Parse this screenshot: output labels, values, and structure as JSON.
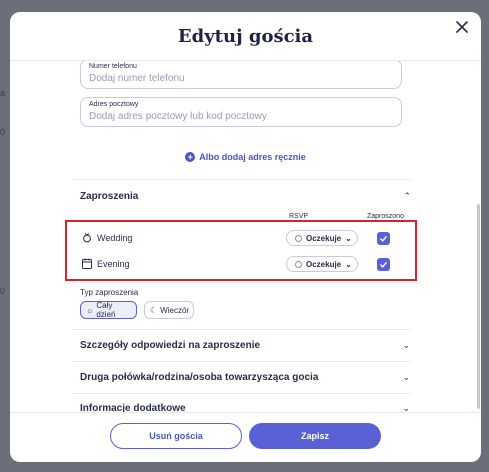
{
  "background": {
    "fragments": [
      "a",
      "0",
      "0"
    ]
  },
  "modal": {
    "title": "Edytuj gościa",
    "close_icon": "close-icon"
  },
  "fields": {
    "phone": {
      "label": "Numer telefonu",
      "placeholder": "Dodaj numer telefonu",
      "value": ""
    },
    "address": {
      "label": "Adres pocztowy",
      "placeholder": "Dodaj adres pocztowy lub kod pocztowy",
      "value": ""
    }
  },
  "add_address_link": "Albo dodaj adres ręcznie",
  "invitations": {
    "title": "Zaproszenia",
    "col_rsvp": "RSVP",
    "col_invited": "Zaproszono",
    "events": [
      {
        "name": "Wedding",
        "icon": "rings-icon",
        "rsvp": "Oczekuje",
        "invited": true
      },
      {
        "name": "Evening",
        "icon": "calendar-icon",
        "rsvp": "Oczekuje",
        "invited": true
      }
    ],
    "type_label": "Typ zaproszenia",
    "type_options": [
      {
        "label": "Cały dzień",
        "icon": "sun-icon",
        "selected": true
      },
      {
        "label": "Wieczór",
        "icon": "moon-icon",
        "selected": false
      }
    ]
  },
  "accordions": [
    "Szczegóły odpowiedzi na zaproszenie",
    "Druga połówka/rodzina/osoba towarzysząca gocia",
    "Informacje dodatkowe"
  ],
  "footer": {
    "delete_label": "Usuń gościa",
    "save_label": "Zapisz"
  },
  "colors": {
    "accent": "#5a61d4",
    "link": "#4a53c9",
    "highlight": "#d8232a",
    "text": "#2a2d49"
  }
}
